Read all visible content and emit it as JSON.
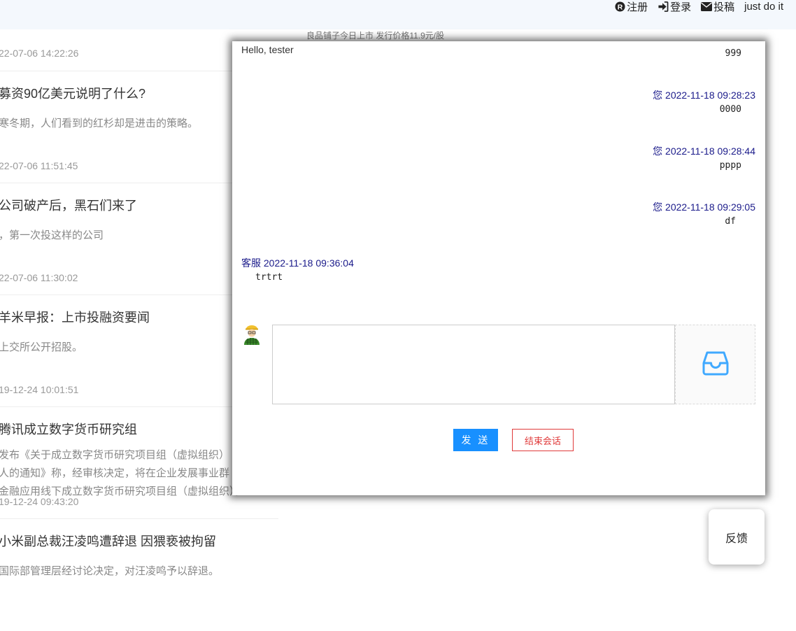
{
  "topnav": {
    "register": "注册",
    "login": "登录",
    "submit": "投稿",
    "slogan": "just do it"
  },
  "ticker": "良品铺子今日上市 发行价格11.9元/股",
  "articles": [
    {
      "date": "22-07-06 14:22:26"
    },
    {
      "title": "募资90亿美元说明了什么?",
      "summary": "寒冬期，人们看到的红杉却是进击的策略。",
      "date": "22-07-06 11:51:45"
    },
    {
      "title": "公司破产后，黑石们来了",
      "summary": "，第一次投这样的公司",
      "date": "22-07-06 11:30:02"
    },
    {
      "title": "羊米早报：上市投融资要闻",
      "summary": "上交所公开招股。",
      "date": "19-12-24 10:01:51"
    },
    {
      "title": "腾讯成立数字货币研究组",
      "summary_lines": [
        "发布《关于成立数字货币研究项目组（虚拟组织）",
        "人的通知》称，经审核决定，将在企业发展事业群",
        "金融应用线下成立数字货币研究项目组（虚拟组织）。"
      ],
      "date": "19-12-24 09:43:20"
    },
    {
      "title": "小米副总裁汪凌鸣遭辞退 因猥亵被拘留",
      "summary": "国际部管理层经讨论决定，对汪凌鸣予以辞退。"
    }
  ],
  "chat": {
    "greeting": "Hello, tester",
    "messages": [
      {
        "side": "right",
        "meta": "",
        "body": "999"
      },
      {
        "side": "right",
        "meta": "您 2022-11-18 09:28:23",
        "body": "0000"
      },
      {
        "side": "right",
        "meta": "您 2022-11-18 09:28:44",
        "body": "pppp"
      },
      {
        "side": "right",
        "meta": "您 2022-11-18 09:29:05",
        "body": "df"
      },
      {
        "side": "left",
        "meta": "客服 2022-11-18 09:36:04",
        "body": "trtrt"
      }
    ],
    "input_value": "",
    "send_label": "发 送",
    "end_label": "结束会话"
  },
  "feedback_label": "反馈",
  "colors": {
    "primary": "#1890ff",
    "danger": "#e03a3a",
    "meta_text": "#1a1a8a",
    "topbar_bg": "#f4f8fd"
  },
  "icons": [
    "registered-icon",
    "sign-in-icon",
    "envelope-icon",
    "user-avatar-icon",
    "inbox-icon"
  ]
}
